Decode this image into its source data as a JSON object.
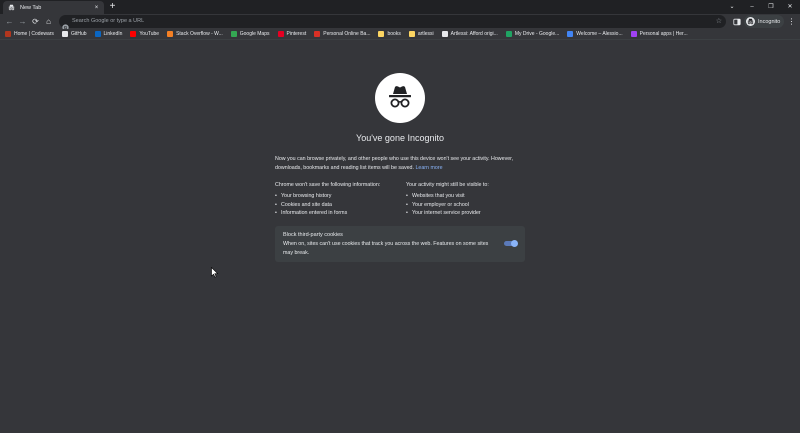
{
  "tab": {
    "title": "New Tab",
    "close_icon": "×"
  },
  "newtab_label": "+",
  "window_controls": {
    "dropdown": "⌄",
    "minimize": "–",
    "restore": "❐",
    "close": "✕"
  },
  "toolbar": {
    "back": "←",
    "forward": "→",
    "reload": "⟳",
    "home": "⌂",
    "omnibox_placeholder": "Search Google or type a URL",
    "star": "☆",
    "profile_label": "Incognito",
    "menu": "⋮"
  },
  "bookmarks": [
    {
      "label": "Home | Codewars",
      "color": "#b1361e"
    },
    {
      "label": "GitHub",
      "color": "#e8eaed"
    },
    {
      "label": "LinkedIn",
      "color": "#0a66c2"
    },
    {
      "label": "YouTube",
      "color": "#ff0000"
    },
    {
      "label": "Stack Overflow - W...",
      "color": "#f48024"
    },
    {
      "label": "Google Maps",
      "color": "#34a853"
    },
    {
      "label": "Pinterest",
      "color": "#e60023"
    },
    {
      "label": "Personal Online Ba...",
      "color": "#d93025"
    },
    {
      "label": "books",
      "color": "#fdd663"
    },
    {
      "label": "artlessi",
      "color": "#fdd663"
    },
    {
      "label": "Artlessi: Afford origi...",
      "color": "#e8eaed"
    },
    {
      "label": "My Drive - Google...",
      "color": "#1fa463"
    },
    {
      "label": "Welcome – Alessio...",
      "color": "#4285f4"
    },
    {
      "label": "Personal apps | Her...",
      "color": "#a142f4"
    }
  ],
  "main": {
    "title": "You've gone Incognito",
    "intro_text": "Now you can browse privately, and other people who use this device won't see your activity. However, downloads, bookmarks and reading list items will be saved.",
    "learn_more": "Learn more",
    "left_heading": "Chrome won't save the following information:",
    "left_items": [
      "Your browsing history",
      "Cookies and site data",
      "Information entered in forms"
    ],
    "right_heading": "Your activity might still be visible to:",
    "right_items": [
      "Websites that you visit",
      "Your employer or school",
      "Your internet service provider"
    ],
    "cookie_title": "Block third-party cookies",
    "cookie_desc": "When on, sites can't use cookies that track you across the web. Features on some sites may break.",
    "cookie_toggle_on": true
  }
}
